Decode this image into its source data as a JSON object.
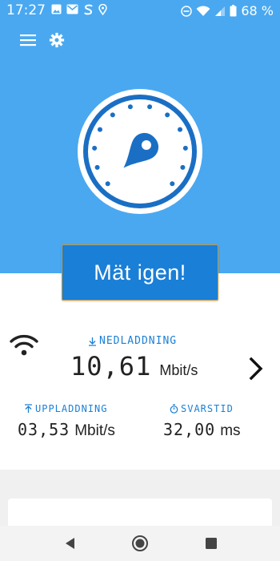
{
  "status_bar": {
    "time": "17:27",
    "battery": "68 %"
  },
  "hero": {
    "button_label": "Mät igen!"
  },
  "results": {
    "download": {
      "label": "NEDLADDNING",
      "value": "10,61",
      "unit": "Mbit/s"
    },
    "upload": {
      "label": "UPPLADDNING",
      "value": "03,53",
      "unit": "Mbit/s"
    },
    "ping": {
      "label": "SVARSTID",
      "value": "32,00",
      "unit": "ms"
    }
  },
  "colors": {
    "hero_bg": "#4aa8f0",
    "accent": "#1a7fd6",
    "gauge_blue": "#1a6fc4"
  },
  "icons": [
    "menu-icon",
    "gear-icon",
    "gauge-icon",
    "wifi-icon",
    "download-icon",
    "upload-icon",
    "timer-icon",
    "chevron-right-icon",
    "nav-back-icon",
    "nav-home-icon",
    "nav-recent-icon"
  ]
}
